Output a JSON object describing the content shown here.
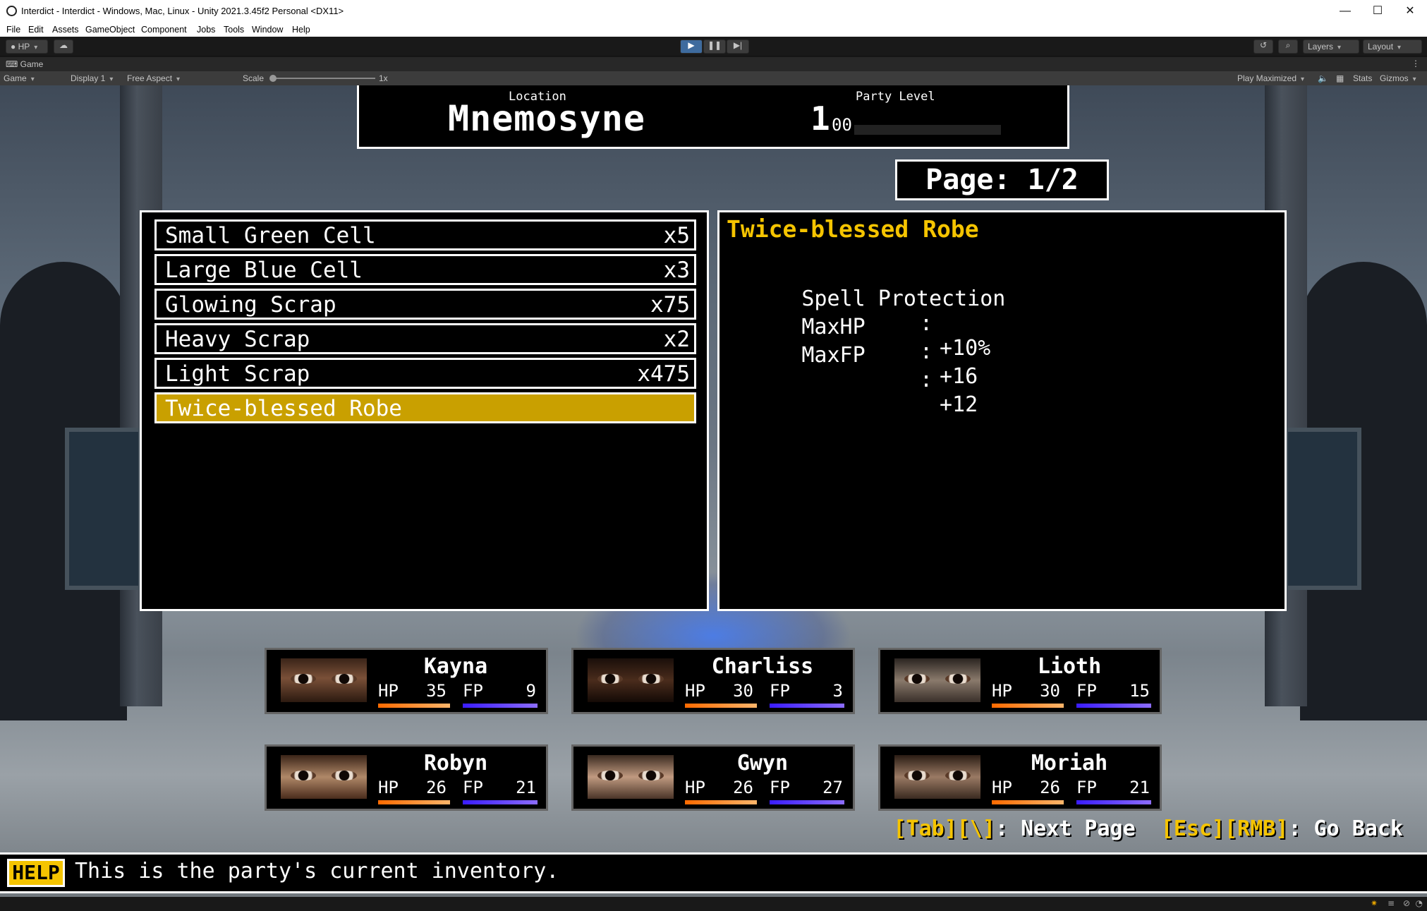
{
  "window": {
    "title": "Interdict - Interdict - Windows, Mac, Linux - Unity 2021.3.45f2 Personal <DX11>",
    "minimize": "—",
    "maximize": "☐",
    "close": "✕"
  },
  "menu": [
    "File",
    "Edit",
    "Assets",
    "GameObject",
    "Component",
    "Jobs",
    "Tools",
    "Window",
    "Help"
  ],
  "toolbar": {
    "account": "HP",
    "layers": "Layers",
    "layout": "Layout"
  },
  "game_tab": {
    "label": "Game",
    "view": "Game",
    "display": "Display 1",
    "aspect": "Free Aspect",
    "scale_label": "Scale",
    "scale_value": "1x",
    "play_mode": "Play Maximized",
    "stats": "Stats",
    "gizmos": "Gizmos"
  },
  "header": {
    "location_label": "Location",
    "location": "Mnemosyne",
    "party_level_label": "Party Level",
    "party_level": "1",
    "party_level_sub": "00",
    "xp_progress": 0
  },
  "page": "Page: 1/2",
  "inventory": [
    {
      "name": "Small Green Cell",
      "qty": "x5"
    },
    {
      "name": "Large Blue Cell",
      "qty": "x3"
    },
    {
      "name": "Glowing Scrap",
      "qty": "x75"
    },
    {
      "name": "Heavy Scrap",
      "qty": "x2"
    },
    {
      "name": "Light Scrap",
      "qty": "x475"
    },
    {
      "name": "Twice-blessed Robe",
      "qty": ""
    }
  ],
  "selected_index": 5,
  "detail": {
    "title": "Twice-blessed Robe",
    "stats": [
      {
        "label": "Spell Protection",
        "value": "+10%"
      },
      {
        "label": "MaxHP",
        "value": "+16"
      },
      {
        "label": "MaxFP",
        "value": "+12"
      }
    ]
  },
  "party": [
    {
      "name": "Kayna",
      "hp": "35",
      "fp": "9"
    },
    {
      "name": "Charliss",
      "hp": "30",
      "fp": "3"
    },
    {
      "name": "Lioth",
      "hp": "30",
      "fp": "15"
    },
    {
      "name": "Robyn",
      "hp": "26",
      "fp": "21"
    },
    {
      "name": "Gwyn",
      "hp": "26",
      "fp": "27"
    },
    {
      "name": "Moriah",
      "hp": "26",
      "fp": "21"
    }
  ],
  "labels": {
    "hp": "HP",
    "fp": "FP"
  },
  "hint": {
    "k1": "[Tab][\\]",
    "t1": ": Next Page  ",
    "k2": "[Esc][RMB]",
    "t2": ": Go Back"
  },
  "help": {
    "badge": "HELP",
    "text": "This is the party's current inventory."
  }
}
